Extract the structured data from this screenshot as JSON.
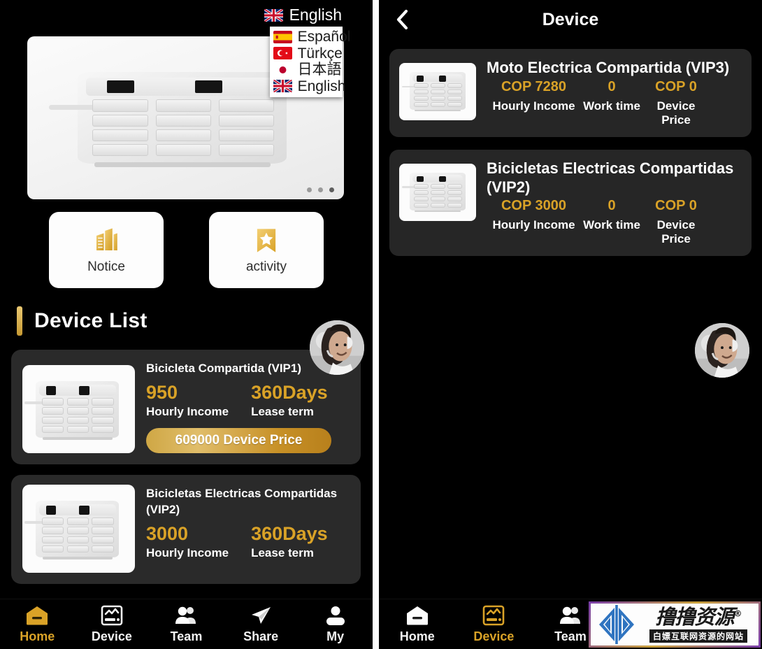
{
  "left": {
    "language": {
      "selected": "English",
      "selected_flag": "uk-flag-icon",
      "options": [
        {
          "label": "Español",
          "flag": "spain-flag-icon"
        },
        {
          "label": "Türkçe",
          "flag": "turkey-flag-icon"
        },
        {
          "label": "日本語",
          "flag": "japan-flag-icon"
        },
        {
          "label": "English",
          "flag": "uk-flag-icon"
        }
      ]
    },
    "banner": {
      "alt": "charging-station-banner",
      "dots_total": 3,
      "dots_active_index": 2
    },
    "quick_actions": [
      {
        "label": "Notice",
        "icon": "building-icon"
      },
      {
        "label": "activity",
        "icon": "star-bookmark-icon"
      }
    ],
    "section_title": "Device List",
    "devices": [
      {
        "name": "Bicicleta Compartida  (VIP1)",
        "hourly_income_value": "950",
        "hourly_income_label": "Hourly Income",
        "lease_term_value": "360Days",
        "lease_term_label": "Lease term",
        "price_button": "609000 Device Price"
      },
      {
        "name": "Bicicletas Electricas Compartidas  (VIP2)",
        "hourly_income_value": "3000",
        "hourly_income_label": "Hourly Income",
        "lease_term_value": "360Days",
        "lease_term_label": "Lease term",
        "price_button": ""
      }
    ],
    "tabs": [
      {
        "label": "Home",
        "icon": "home-icon",
        "active": true
      },
      {
        "label": "Device",
        "icon": "device-icon",
        "active": false
      },
      {
        "label": "Team",
        "icon": "team-icon",
        "active": false
      },
      {
        "label": "Share",
        "icon": "share-icon",
        "active": false
      },
      {
        "label": "My",
        "icon": "user-icon",
        "active": false
      }
    ],
    "support_avatar": "customer-service-avatar"
  },
  "right": {
    "header": {
      "title": "Device",
      "back_icon": "chevron-left-icon"
    },
    "devices": [
      {
        "name": "Moto Electrica Compartida  (VIP3)",
        "hourly_income_value": "COP 7280",
        "hourly_income_label": "Hourly Income",
        "work_time_value": "0",
        "work_time_label": "Work time",
        "device_price_value": "COP 0",
        "device_price_label": "Device Price"
      },
      {
        "name": "Bicicletas Electricas Compartidas  (VIP2)",
        "hourly_income_value": "COP 3000",
        "hourly_income_label": "Hourly Income",
        "work_time_value": "0",
        "work_time_label": "Work time",
        "device_price_value": "COP 0",
        "device_price_label": "Device Price"
      }
    ],
    "tabs": [
      {
        "label": "Home",
        "icon": "home-icon",
        "active": false
      },
      {
        "label": "Device",
        "icon": "device-icon",
        "active": true
      },
      {
        "label": "Team",
        "icon": "team-icon",
        "active": false
      }
    ],
    "support_avatar": "customer-service-avatar"
  },
  "watermark": {
    "main_text": "撸撸资源",
    "registered": "®",
    "sub_text": "白嫖互联网资源的网站"
  },
  "colors": {
    "accent_gold": "#d9a227",
    "card_bg": "#2a2a2a",
    "page_bg": "#000000",
    "text_primary": "#ffffff"
  }
}
